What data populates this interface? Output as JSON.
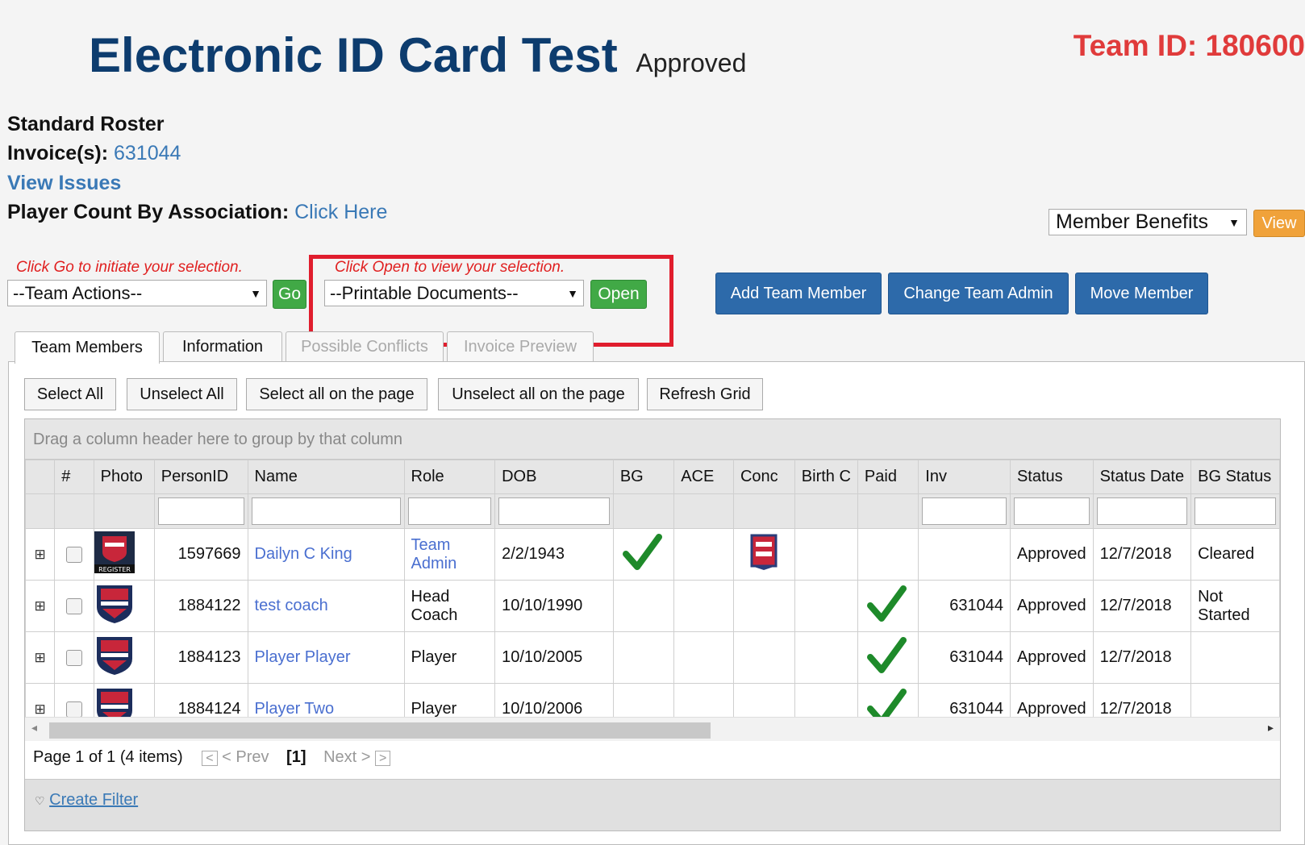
{
  "header": {
    "title": "Electronic ID Card Test",
    "status": "Approved",
    "team_id": "Team ID: 180600"
  },
  "info": {
    "roster_type": "Standard Roster",
    "invoice_label": "Invoice(s):",
    "invoice_value": "631044",
    "view_issues": "View Issues",
    "player_count_label": "Player Count By Association:",
    "player_count_link": "Click Here"
  },
  "member_benefits": {
    "select_value": "Member Benefits",
    "view_button": "View"
  },
  "actions": {
    "go_hint": "Click Go to initiate your selection.",
    "team_actions_value": "--Team Actions--",
    "go_button": "Go",
    "open_hint": "Click Open to view your selection.",
    "printable_docs_value": "--Printable Documents--",
    "open_button": "Open",
    "add_team_member": "Add Team Member",
    "change_team_admin": "Change Team Admin",
    "move_member": "Move Member"
  },
  "tabs": [
    "Team Members",
    "Information",
    "Possible Conflicts",
    "Invoice Preview"
  ],
  "grid_buttons": {
    "select_all": "Select All",
    "unselect_all": "Unselect All",
    "select_all_page": "Select all on the page",
    "unselect_all_page": "Unselect all on the page",
    "refresh_grid": "Refresh Grid"
  },
  "grid": {
    "group_hint": "Drag a column header here to group by that column",
    "columns": [
      "",
      "#",
      "Photo",
      "PersonID",
      "Name",
      "Role",
      "DOB",
      "BG",
      "ACE",
      "Conc",
      "Birth C",
      "Paid",
      "Inv",
      "Status",
      "Status Date",
      "BG Status"
    ],
    "rows": [
      {
        "person_id": "1597669",
        "name": "Dailyn C King",
        "role_line1": "Team",
        "role_line2": "Admin",
        "role_link": true,
        "dob": "2/2/1943",
        "bg": true,
        "conc": true,
        "paid": false,
        "inv": "",
        "status": "Approved",
        "status_date": "12/7/2018",
        "bg_status_line1": "Cleared",
        "bg_status_line2": "",
        "photo": "register-badge"
      },
      {
        "person_id": "1884122",
        "name": "test coach",
        "role_line1": "Head",
        "role_line2": "Coach",
        "role_link": false,
        "dob": "10/10/1990",
        "bg": false,
        "conc": false,
        "paid": true,
        "inv": "631044",
        "status": "Approved",
        "status_date": "12/7/2018",
        "bg_status_line1": "Not",
        "bg_status_line2": "Started",
        "photo": "usa-softball-shield"
      },
      {
        "person_id": "1884123",
        "name": "Player Player",
        "role_line1": "Player",
        "role_line2": "",
        "role_link": false,
        "dob": "10/10/2005",
        "bg": false,
        "conc": false,
        "paid": true,
        "inv": "631044",
        "status": "Approved",
        "status_date": "12/7/2018",
        "bg_status_line1": "",
        "bg_status_line2": "",
        "photo": "usa-softball-shield"
      },
      {
        "person_id": "1884124",
        "name": "Player Two",
        "role_line1": "Player",
        "role_line2": "",
        "role_link": false,
        "dob": "10/10/2006",
        "bg": false,
        "conc": false,
        "paid": true,
        "inv": "631044",
        "status": "Approved",
        "status_date": "12/7/2018",
        "bg_status_line1": "",
        "bg_status_line2": "",
        "photo": "usa-softball-shield"
      }
    ]
  },
  "pager": {
    "summary": "Page 1 of 1 (4 items)",
    "prev": "< Prev",
    "current": "[1]",
    "next": "Next >"
  },
  "footer": {
    "create_filter": "Create Filter"
  },
  "colors": {
    "title": "#0d3c6e",
    "team_id": "#e03b3b",
    "highlight_box": "#e01d2d",
    "blue_button": "#2d6aaa",
    "green_button": "#41a946",
    "check": "#1e8a2a"
  }
}
